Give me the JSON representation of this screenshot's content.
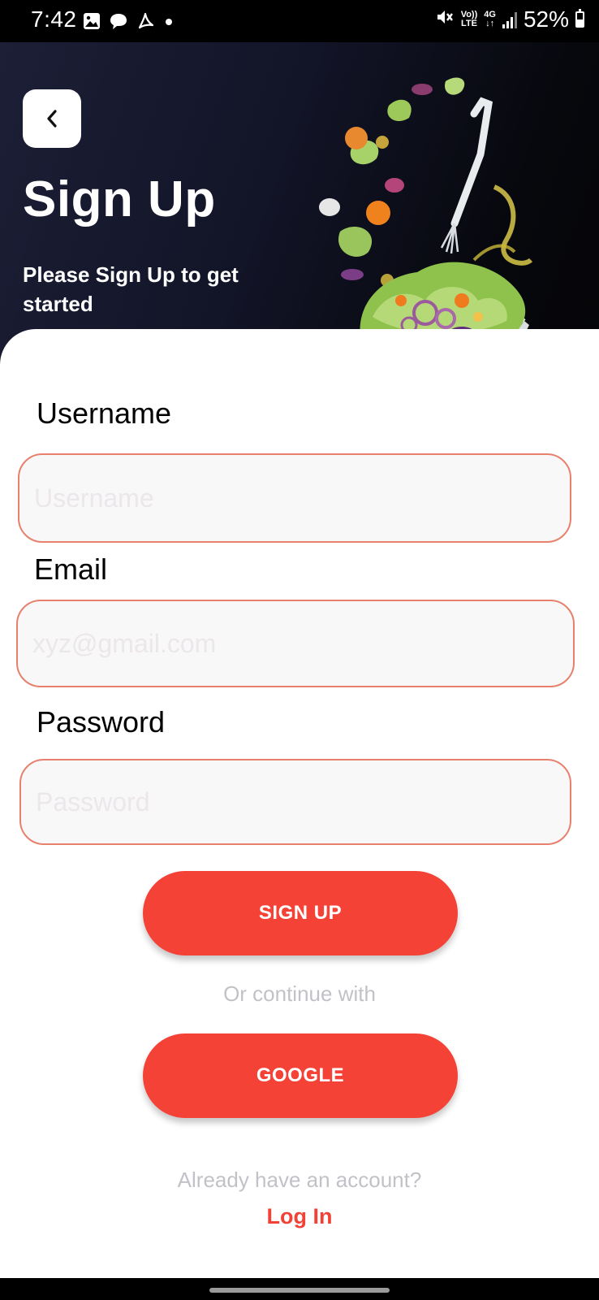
{
  "status_bar": {
    "time": "7:42",
    "volte_label_top": "Vo))",
    "volte_label_bottom": "LTE",
    "network_label": "4G",
    "network_arrows": "↓↑",
    "battery": "52%",
    "battery_level": 0.52,
    "icons": [
      "gallery-icon",
      "chat-icon",
      "pdf-icon",
      "dot-icon",
      "mute-icon",
      "volte-icon",
      "network-4g-icon",
      "signal-icon",
      "battery-icon"
    ]
  },
  "header": {
    "title": "Sign Up",
    "subtitle": "Please Sign Up to get started",
    "back_icon": "chevron-left-icon",
    "illustration": "salad-bowl-illustration"
  },
  "form": {
    "username": {
      "label": "Username",
      "placeholder": "Username",
      "value": ""
    },
    "email": {
      "label": "Email",
      "placeholder": "xyz@gmail.com",
      "value": ""
    },
    "password": {
      "label": "Password",
      "placeholder": "Password",
      "value": ""
    },
    "signup_button": "SIGN UP",
    "divider_text": "Or continue with",
    "google_button": "GOOGLE",
    "account_prompt": "Already have an account?",
    "login_link": "Log In"
  },
  "colors": {
    "accent": "#f44336",
    "input_border": "#e7806d",
    "input_bg": "#f9f8f9",
    "header_bg": "#121427",
    "muted_text": "#c3c1c8"
  }
}
